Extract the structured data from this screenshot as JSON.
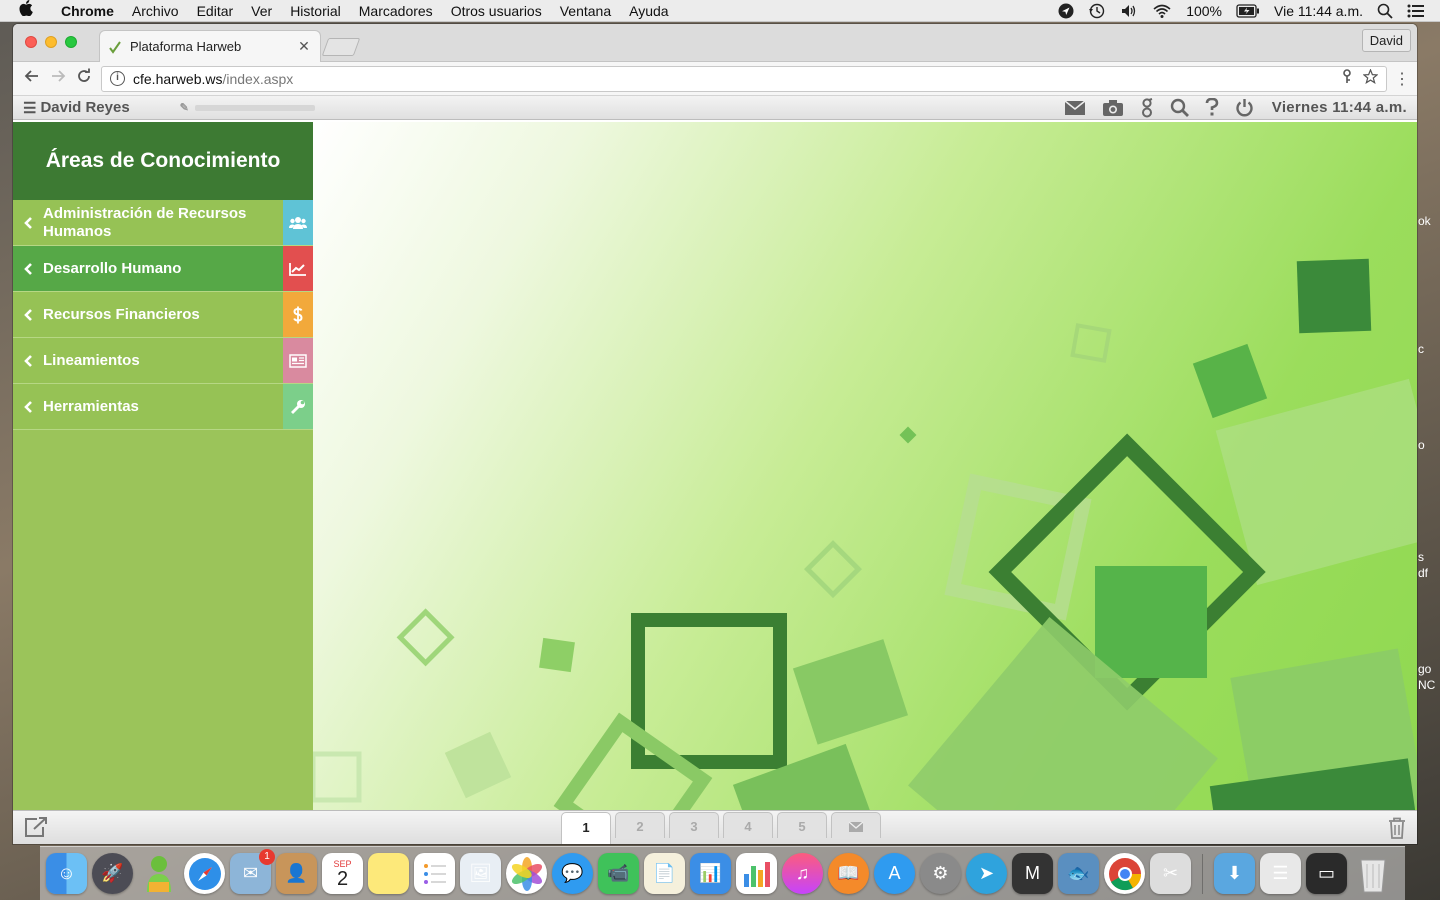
{
  "menubar": {
    "app": "Chrome",
    "items": [
      "Archivo",
      "Editar",
      "Ver",
      "Historial",
      "Marcadores",
      "Otros usuarios",
      "Ventana",
      "Ayuda"
    ],
    "battery": "100%",
    "clock": "Vie 11:44 a.m."
  },
  "browser": {
    "tab_title": "Plataforma Harweb",
    "profile": "David",
    "url_host": "cfe.harweb.ws",
    "url_path": "/index.aspx"
  },
  "appbar": {
    "username": "David Reyes",
    "datetime": "Viernes 11:44 a.m.",
    "tools": [
      "envelope-icon",
      "camera-icon",
      "google-icon",
      "search-icon",
      "help-icon",
      "power-icon"
    ]
  },
  "sidebar": {
    "title": "Áreas de Conocimiento",
    "items": [
      {
        "label": "Administración de Recursos Humanos",
        "icon": "users-icon",
        "color": "#5fc3d6"
      },
      {
        "label": "Desarrollo Humano",
        "icon": "chart-icon",
        "color": "#e24f4f"
      },
      {
        "label": "Recursos Financieros",
        "icon": "dollar-icon",
        "color": "#f2a93b"
      },
      {
        "label": "Lineamientos",
        "icon": "document-icon",
        "color": "#d98a9f"
      },
      {
        "label": "Herramientas",
        "icon": "wrench-icon",
        "color": "#7ccf8a"
      }
    ],
    "active_index": 1
  },
  "pager": {
    "pages": [
      "1",
      "2",
      "3",
      "4",
      "5"
    ],
    "active": "1"
  },
  "right_edge_fragments": [
    "ok",
    "c",
    "o",
    "s",
    "df",
    "go",
    "NC"
  ],
  "dock_badge": "1",
  "dock_calendar_month": "SEP",
  "dock_calendar_day": "2",
  "colors": {
    "sidebar_header": "#3d7a33",
    "sidebar_bg": "#96c255",
    "active_item": "#56a847",
    "stage_green": "#8fd850"
  }
}
